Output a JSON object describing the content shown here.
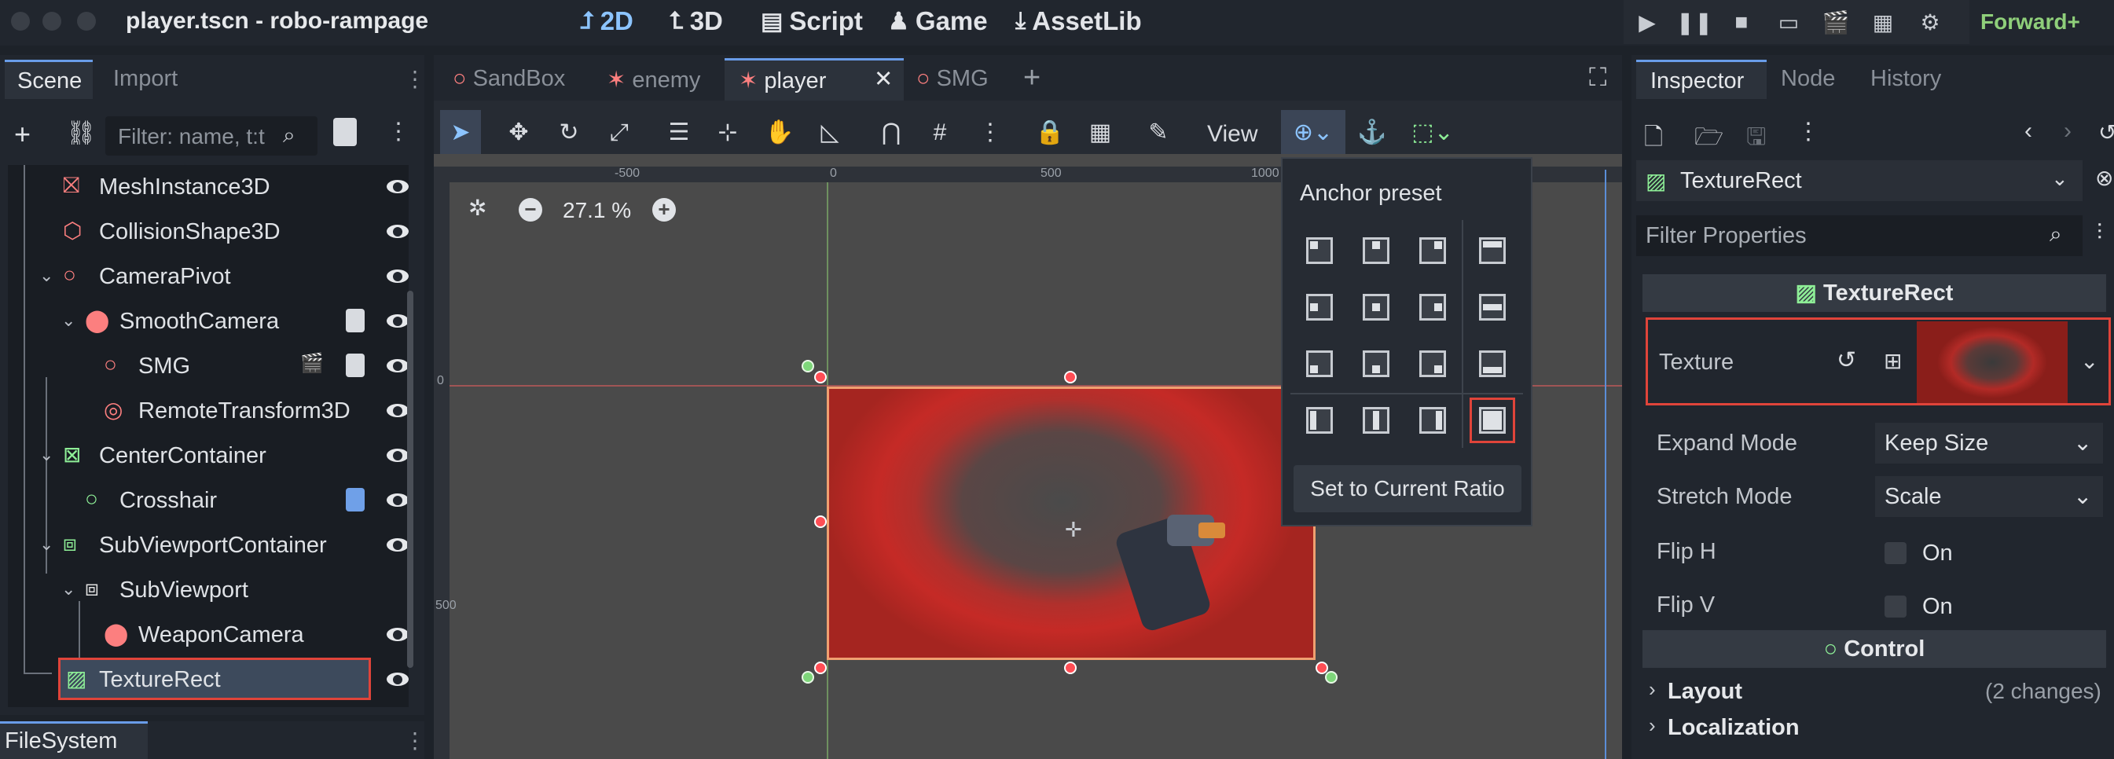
{
  "window": {
    "title": "player.tscn - robo-rampage",
    "modes": [
      "2D",
      "3D",
      "Script",
      "Game",
      "AssetLib"
    ],
    "renderer": "Forward+"
  },
  "scene_panel": {
    "tabs": [
      "Scene",
      "Import"
    ],
    "filter_placeholder": "Filter: name, t:t",
    "tree": [
      {
        "label": "MeshInstance3D",
        "icon": "mesh-instance-icon",
        "color": "#fc7f7f"
      },
      {
        "label": "CollisionShape3D",
        "icon": "collision-shape-icon",
        "color": "#fc7f7f"
      },
      {
        "label": "CameraPivot",
        "icon": "node3d-icon",
        "color": "#fc7f7f"
      },
      {
        "label": "SmoothCamera",
        "icon": "camera-icon",
        "color": "#fc7f7f"
      },
      {
        "label": "SMG",
        "icon": "node3d-icon",
        "color": "#fc7f7f"
      },
      {
        "label": "RemoteTransform3D",
        "icon": "remote-transform-icon",
        "color": "#fc7f7f"
      },
      {
        "label": "CenterContainer",
        "icon": "center-container-icon",
        "color": "#8eef97"
      },
      {
        "label": "Crosshair",
        "icon": "control-icon",
        "color": "#8eef97"
      },
      {
        "label": "SubViewportContainer",
        "icon": "subviewport-container-icon",
        "color": "#8eef97"
      },
      {
        "label": "SubViewport",
        "icon": "subviewport-icon",
        "color": "#e0e0e0"
      },
      {
        "label": "WeaponCamera",
        "icon": "camera-icon",
        "color": "#fc7f7f"
      },
      {
        "label": "TextureRect",
        "icon": "texture-rect-icon",
        "color": "#8eef97"
      }
    ],
    "filesystem_tab": "FileSystem"
  },
  "editor": {
    "scene_tabs": [
      "SandBox",
      "enemy",
      "player",
      "SMG"
    ],
    "active_tab": "player",
    "view_label": "View",
    "zoom": "27.1 %",
    "ruler_labels": [
      "-500",
      "0",
      "500",
      "1000"
    ],
    "ruler_v_labels": [
      "0",
      "500"
    ]
  },
  "anchor_popup": {
    "title": "Anchor preset",
    "button": "Set to Current Ratio"
  },
  "inspector": {
    "tabs": [
      "Inspector",
      "Node",
      "History"
    ],
    "node_name": "TextureRect",
    "filter_placeholder": "Filter Properties",
    "class_header": "TextureRect",
    "texture_label": "Texture",
    "properties": [
      {
        "label": "Expand Mode",
        "value": "Keep Size"
      },
      {
        "label": "Stretch Mode",
        "value": "Scale"
      }
    ],
    "flips": [
      {
        "label": "Flip H",
        "value": "On"
      },
      {
        "label": "Flip V",
        "value": "On"
      }
    ],
    "control_header": "Control",
    "sections": [
      {
        "label": "Layout",
        "note": "(2 changes)"
      },
      {
        "label": "Localization",
        "note": ""
      }
    ]
  }
}
